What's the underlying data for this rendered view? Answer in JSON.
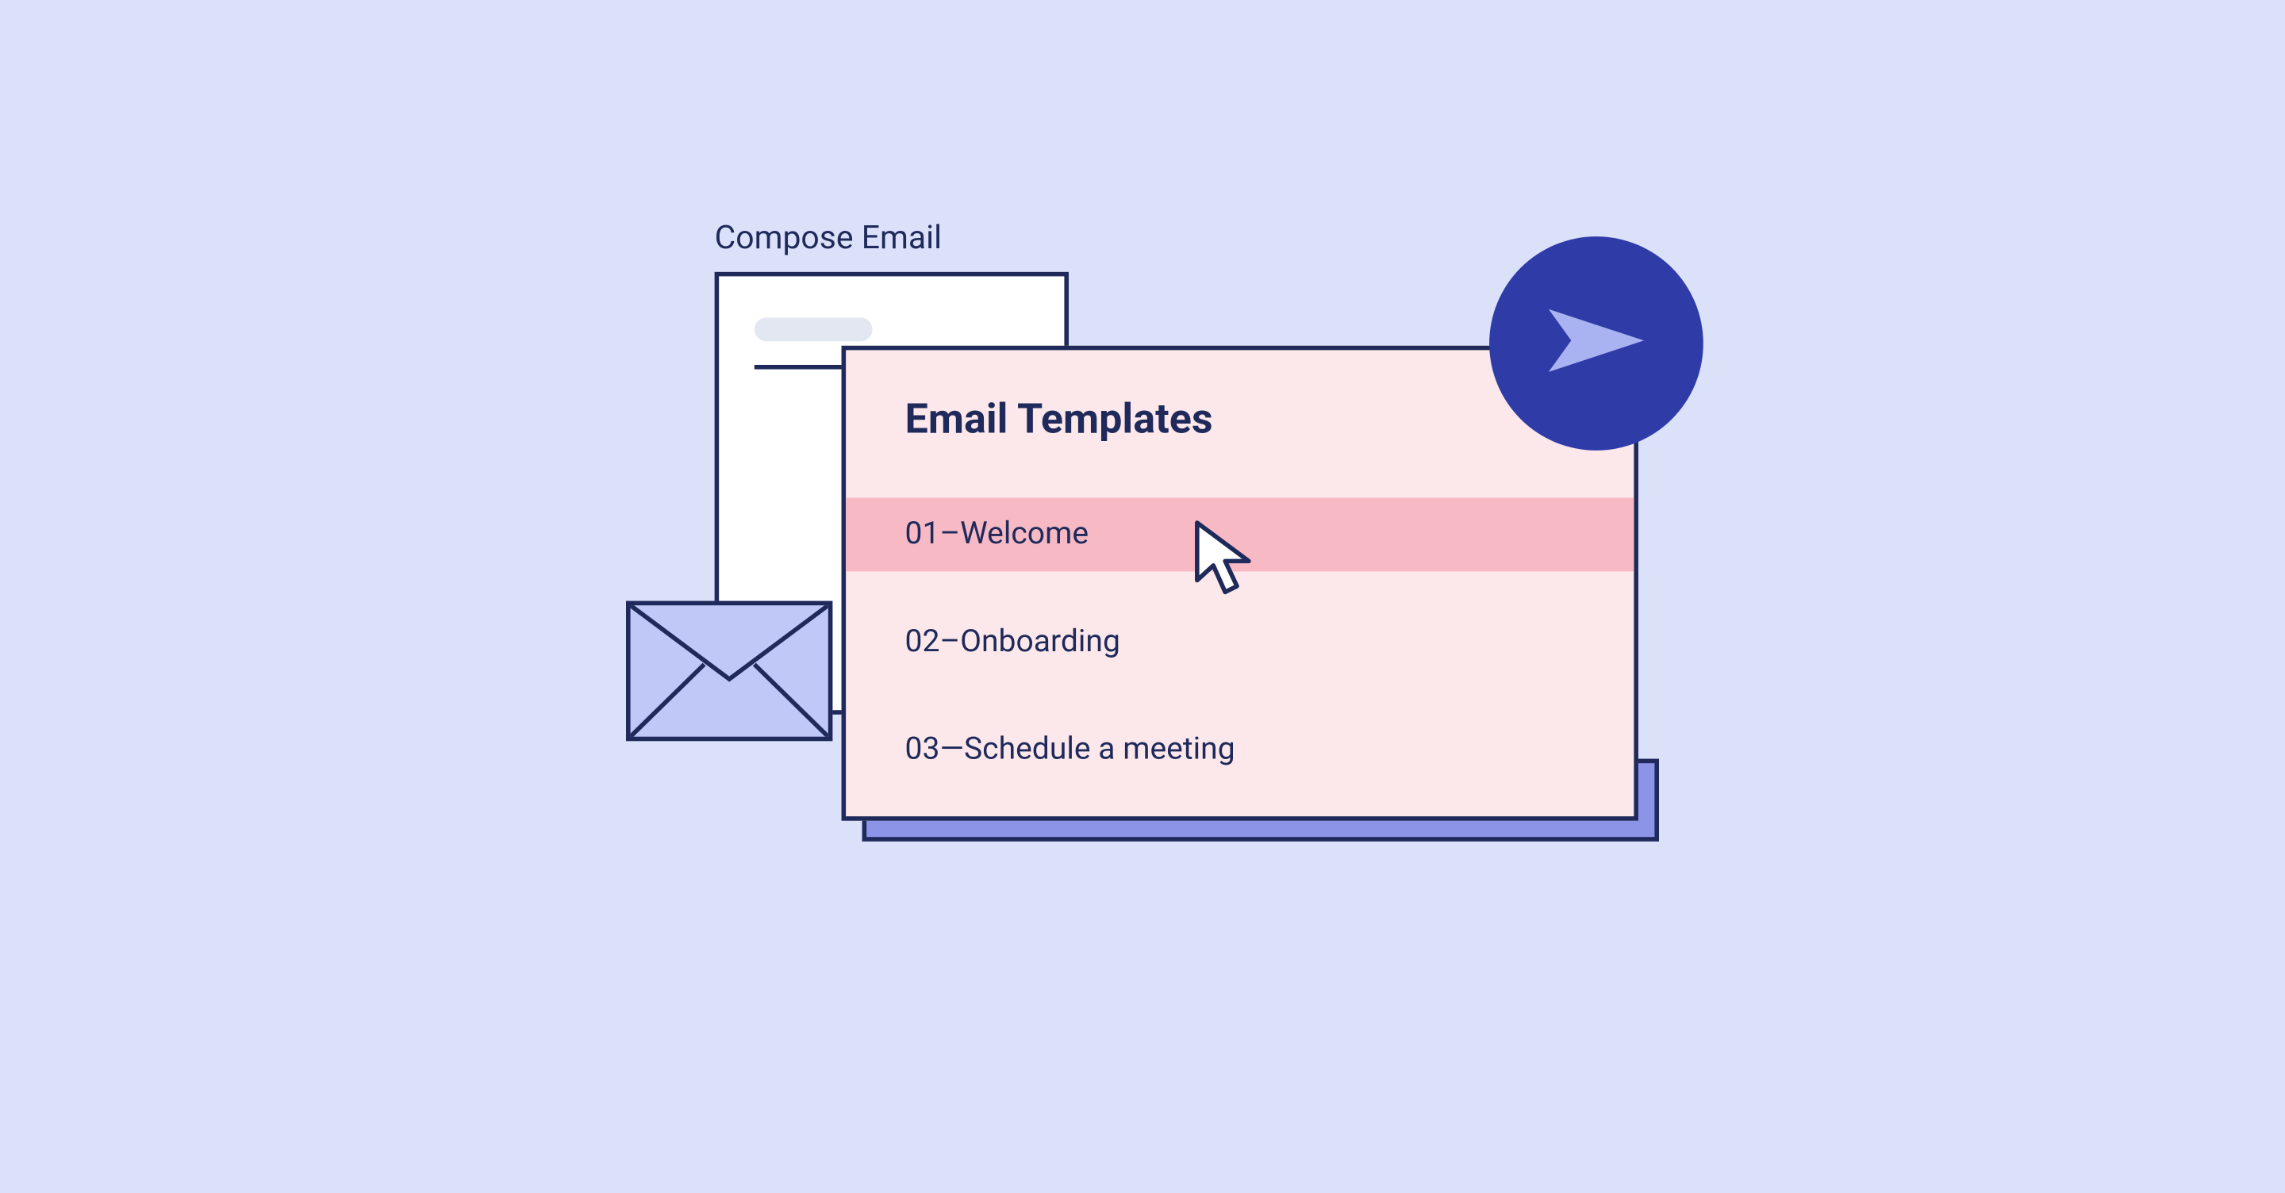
{
  "compose": {
    "label": "Compose Email"
  },
  "templates": {
    "title": "Email Templates",
    "items": [
      {
        "label": "01–Welcome"
      },
      {
        "label": "02–Onboarding"
      },
      {
        "label": "03—Schedule a meeting"
      }
    ],
    "selected_index": 0
  },
  "colors": {
    "background": "#DCE1FA",
    "outline": "#1F2A5B",
    "card_pink": "#FCE8EA",
    "highlight_pink": "#F7BAC5",
    "shadow_purple": "#8C94E8",
    "envelope_fill": "#BFC8F7",
    "send_button": "#2F3CA8",
    "send_arrow": "#A9B3F2"
  }
}
